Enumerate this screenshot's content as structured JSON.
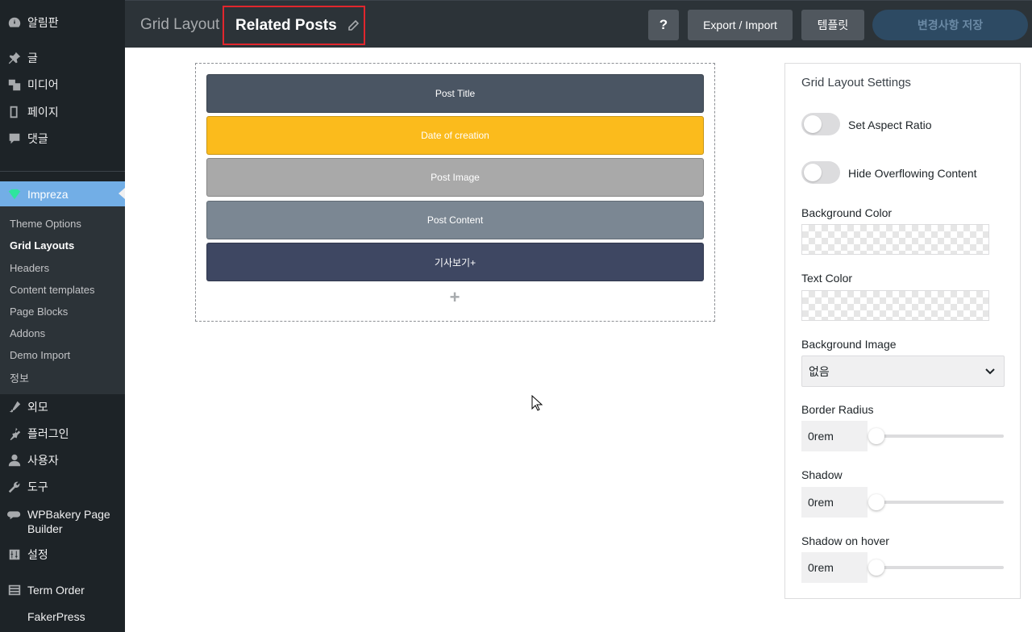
{
  "sidebar": {
    "items": [
      {
        "label": "알림판",
        "icon": "dashboard-icon"
      },
      {
        "label": "글",
        "icon": "pin-icon"
      },
      {
        "label": "미디어",
        "icon": "media-icon"
      },
      {
        "label": "페이지",
        "icon": "page-icon"
      },
      {
        "label": "댓글",
        "icon": "comment-icon"
      },
      {
        "label": "Impreza",
        "icon": "impreza-icon"
      },
      {
        "label": "외모",
        "icon": "appearance-icon"
      },
      {
        "label": "플러그인",
        "icon": "plugin-icon"
      },
      {
        "label": "사용자",
        "icon": "user-icon"
      },
      {
        "label": "도구",
        "icon": "wrench-icon"
      },
      {
        "label": "WPBakery Page Builder",
        "icon": "wpbakery-icon"
      },
      {
        "label": "설정",
        "icon": "settings-icon"
      },
      {
        "label": "Term Order",
        "icon": "list-icon"
      },
      {
        "label": "FakerPress",
        "icon": ""
      }
    ],
    "submenu": [
      {
        "label": "Theme Options"
      },
      {
        "label": "Grid Layouts"
      },
      {
        "label": "Headers"
      },
      {
        "label": "Content templates"
      },
      {
        "label": "Page Blocks"
      },
      {
        "label": "Addons"
      },
      {
        "label": "Demo Import"
      },
      {
        "label": "정보"
      }
    ]
  },
  "header": {
    "breadcrumb": "Grid Layout",
    "title": "Related Posts",
    "help_label": "?",
    "export_label": "Export / Import",
    "template_label": "템플릿",
    "save_label": "변경사항 저장"
  },
  "canvas": {
    "rows": [
      {
        "label": "Post Title",
        "color": "#4a5563"
      },
      {
        "label": "Date of creation",
        "color": "#fbbb1c"
      },
      {
        "label": "Post Image",
        "color": "#a9a9a9"
      },
      {
        "label": "Post Content",
        "color": "#7b8793"
      },
      {
        "label": "기사보기+",
        "color": "#3e4762"
      }
    ],
    "add_label": "+"
  },
  "settings": {
    "heading": "Grid Layout Settings",
    "aspect_ratio_label": "Set Aspect Ratio",
    "aspect_ratio_on": false,
    "hide_overflow_label": "Hide Overflowing Content",
    "hide_overflow_on": false,
    "bg_color_label": "Background Color",
    "text_color_label": "Text Color",
    "bg_image_label": "Background Image",
    "bg_image_value": "없음",
    "border_radius_label": "Border Radius",
    "border_radius_value": "0rem",
    "shadow_label": "Shadow",
    "shadow_value": "0rem",
    "shadow_hover_label": "Shadow on hover",
    "shadow_hover_value": "0rem"
  }
}
